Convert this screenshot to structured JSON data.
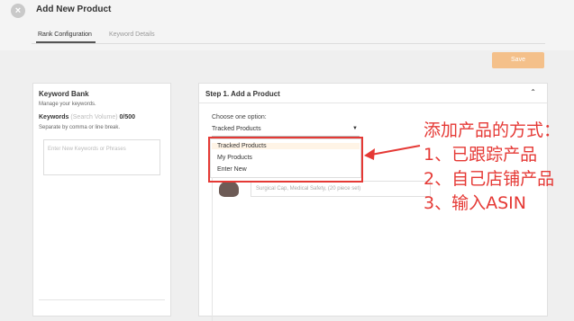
{
  "header": {
    "title": "Add New Product",
    "tabs": [
      {
        "label": "Rank Configuration",
        "active": true
      },
      {
        "label": "Keyword Details",
        "active": false
      }
    ],
    "close_icon": "close-icon",
    "save_label": "Save"
  },
  "keyword_bank": {
    "title": "Keyword Bank",
    "subtitle": "Manage your keywords.",
    "keywords_label": "Keywords",
    "search_volume_label": "(Search Volume)",
    "count": "0/500",
    "separator_hint": "Separate by comma or line break.",
    "input_placeholder": "Enter New Keywords or Phrases"
  },
  "step1": {
    "title": "Step 1. Add a Product",
    "choose_label": "Choose one option:",
    "selected_value": "Tracked Products",
    "options": [
      "Tracked Products",
      "My Products",
      "Enter New"
    ],
    "product_placeholder": "Surgical Cap, Medical Safety, (20 piece set)"
  },
  "annotation": {
    "lines": [
      "添加产品的方式：",
      "1、已跟踪产品",
      "2、自己店铺产品",
      "3、输入ASIN"
    ],
    "color": "#e53935"
  },
  "colors": {
    "accent": "#f4c08a",
    "highlight": "#e53935"
  }
}
